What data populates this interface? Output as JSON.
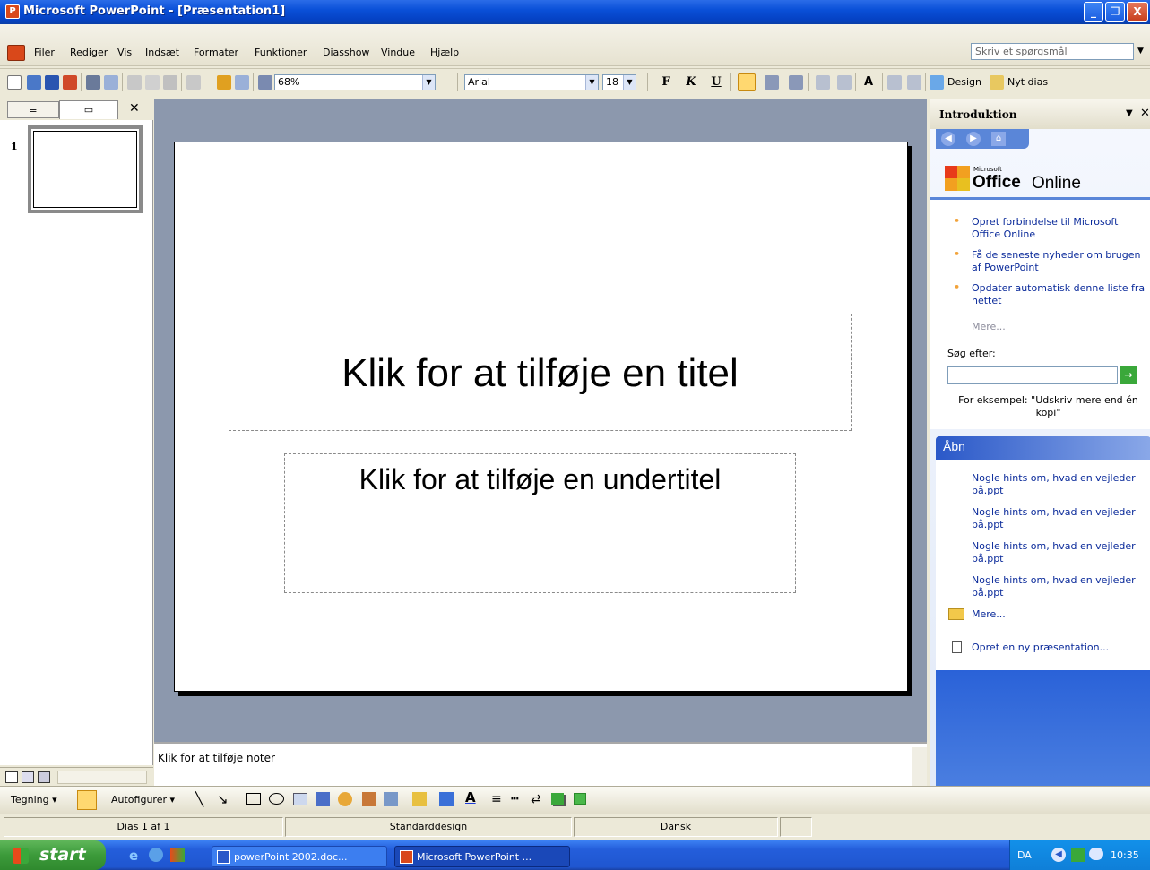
{
  "window": {
    "title": "Microsoft PowerPoint - [Præsentation1]",
    "minimize_glyph": "_",
    "restore_glyph": "❐",
    "close_glyph": "X"
  },
  "menu": {
    "items": [
      "Filer",
      "Rediger",
      "Vis",
      "Indsæt",
      "Formater",
      "Funktioner",
      "Diasshow",
      "Vindue",
      "Hjælp"
    ],
    "ask_placeholder": "Skriv et spørgsmål"
  },
  "toolbar": {
    "zoom": "68%",
    "font": "Arial",
    "font_size": "18",
    "bold_label": "F",
    "italic_label": "K",
    "underline_label": "U",
    "design_label": "Design",
    "new_slide_label": "Nyt dias"
  },
  "outline": {
    "slide_number": "1"
  },
  "slide": {
    "title_placeholder": "Klik for at tilføje en titel",
    "subtitle_placeholder": "Klik for at tilføje en undertitel"
  },
  "notes": {
    "placeholder": "Klik for at tilføje noter"
  },
  "taskpane": {
    "title": "Introduktion",
    "office_online_brand_small": "Microsoft",
    "office_online_brand_office": "Office",
    "office_online_brand_online": "Online",
    "links": [
      "Opret forbindelse til Microsoft Office Online",
      "Få de seneste nyheder om brugen af PowerPoint",
      "Opdater automatisk denne liste fra nettet"
    ],
    "more_label": "Mere...",
    "search_label": "Søg efter:",
    "example_text": "For eksempel: \"Udskriv mere end én kopi\"",
    "open_heading": "Åbn",
    "recent_files": [
      "Nogle hints om, hvad en vejleder på.ppt",
      "Nogle hints om, hvad en vejleder på.ppt",
      "Nogle hints om, hvad en vejleder på.ppt",
      "Nogle hints om, hvad en vejleder på.ppt"
    ],
    "open_more_label": "Mere...",
    "new_presentation_label": "Opret en ny præsentation..."
  },
  "drawing": {
    "drawing_label": "Tegning",
    "autoshapes_label": "Autofigurer"
  },
  "status": {
    "slide_info": "Dias 1 af 1",
    "design": "Standarddesign",
    "language": "Dansk"
  },
  "taskbar": {
    "start_label": "start",
    "tasks": [
      "powerPoint 2002.doc...",
      "Microsoft PowerPoint ..."
    ],
    "lang": "DA",
    "clock": "10:35"
  },
  "colors": {
    "titlebar": "#0a50d8",
    "taskpane_heading": "#2454c8",
    "slide_area": "#8c98ad",
    "taskbar": "#245edb",
    "start_green": "#3c9a3a"
  }
}
